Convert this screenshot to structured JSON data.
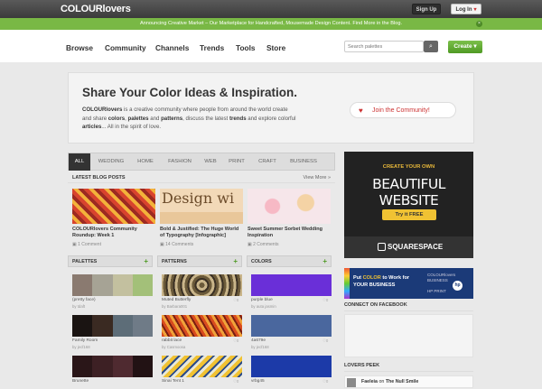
{
  "topbar": {
    "logo": "COLOURlovers",
    "signup": "Sign Up",
    "login": "Log In"
  },
  "announce": {
    "text": "Announcing Creative Market – Our Marketplace for Handcrafted, Mousemade Design Content. Find More in the Blog."
  },
  "nav": {
    "items": [
      "Browse",
      "Community",
      "Channels",
      "Trends",
      "Tools",
      "Store"
    ],
    "search_placeholder": "Search palettes",
    "create": "Create"
  },
  "hero": {
    "title": "Share Your Color Ideas & Inspiration.",
    "brand": "COLOURlovers",
    "text_1": " is a creative community where people from around the world create",
    "text_2": "and share ",
    "colors": "colors",
    "comma": ", ",
    "palettes": "palettes",
    "and": " and ",
    "patterns": "patterns",
    "text_3": ", discuss the latest ",
    "trends": "trends",
    "text_4": " and explore colorful",
    "articles": "articles",
    "text_5": "... All in the spirit of love.",
    "join": "Join the Community!"
  },
  "tabs": [
    "ALL",
    "WEDDING",
    "HOME",
    "FASHION",
    "WEB",
    "PRINT",
    "CRAFT",
    "BUSINESS"
  ],
  "blog": {
    "heading": "LATEST BLOG POSTS",
    "more": "View More »",
    "posts": [
      {
        "title": "COLOURlovers Community Roundup: Week 1",
        "comments": "1 Comment"
      },
      {
        "title": "Bold & Justified: The Huge World of Typography [Infographic]",
        "comments": "14 Comments",
        "image_text": "Design wi"
      },
      {
        "title": "Sweet Summer Sorbet Wedding Inspiration",
        "comments": "2 Comments"
      }
    ]
  },
  "columns": {
    "palettes": {
      "heading": "PALETTES",
      "items": [
        {
          "name": "(pretty face)",
          "by": "by tdaft",
          "colors": [
            "#8a7a70",
            "#a6a395",
            "#c3c09f",
            "#a3c079"
          ]
        },
        {
          "name": "Family Room",
          "by": "by jecf168",
          "colors": [
            "#1a1412",
            "#3a2a22",
            "#5d6d78",
            "#6f7b87"
          ]
        },
        {
          "name": "Brunette",
          "by": "",
          "colors": [
            "#2a1618",
            "#3d2024",
            "#4f2a30",
            "#221214"
          ]
        }
      ]
    },
    "patterns": {
      "heading": "PATTERNS",
      "items": [
        {
          "name": "Muted Butterfly",
          "by": "by Barbara001",
          "count": "0"
        },
        {
          "name": "rabbit lace",
          "by": "by Casmoosa",
          "count": "0"
        },
        {
          "name": "Sinai Tent 1",
          "by": "",
          "count": "0"
        }
      ]
    },
    "colors": {
      "heading": "COLORS",
      "items": [
        {
          "name": "purple blue",
          "by": "by auta jasmin",
          "count": "0",
          "color": "#6a2fd8"
        },
        {
          "name": "4a679e",
          "by": "by jecf168",
          "count": "0",
          "color": "#4a679e"
        },
        {
          "name": "vrbg45",
          "by": "",
          "count": "0",
          "color": "#1c3aa8"
        }
      ]
    }
  },
  "ad1": {
    "title": "CREATE YOUR OWN",
    "big": "BEAUTIFUL WEBSITE",
    "btn": "Try it FREE",
    "footer": "SQUARESPACE"
  },
  "ad2": {
    "line1": "Put ",
    "color": "COLOR",
    "line2": " to Work for",
    "line3": "YOUR BUSINESS",
    "right1": "COLOURlovers",
    "right2": "BUSINESS",
    "right3": "HP PRINT",
    "hp": "hp"
  },
  "facebook": {
    "heading": "CONNECT ON FACEBOOK"
  },
  "peek": {
    "heading": "LOVERS PEEK",
    "name": "Faeleia",
    "on": " on ",
    "title": "The Null Smile"
  },
  "colors": {
    "accent_green": "#79b845",
    "brand_dark": "#3b3b3b",
    "heart_red": "#cc3333"
  }
}
